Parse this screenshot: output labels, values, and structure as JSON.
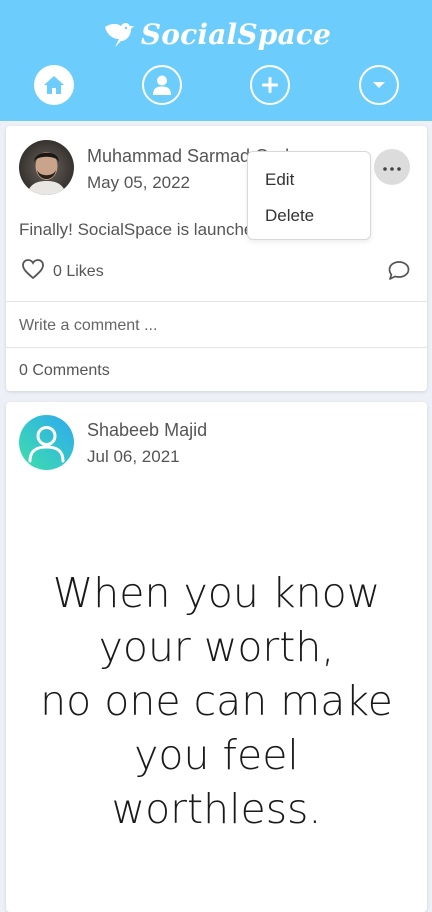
{
  "header": {
    "brand_name": "SocialSpace",
    "nav": [
      {
        "name": "home",
        "icon": "home-icon",
        "active": true
      },
      {
        "name": "profile",
        "icon": "user-icon",
        "active": false
      },
      {
        "name": "create",
        "icon": "plus-icon",
        "active": false
      },
      {
        "name": "menu",
        "icon": "chevron-down-icon",
        "active": false
      }
    ]
  },
  "colors": {
    "header_bg": "#6ccdfc",
    "page_bg": "#eef0f8",
    "accent_gradient": [
      "#3ee0a8",
      "#2ea9f2"
    ]
  },
  "posts": [
    {
      "author": "Muhammad Sarmad Qadeer",
      "date": "May 05, 2022",
      "text": "Finally! SocialSpace is launched",
      "likes_label": "0 Likes",
      "comment_placeholder": "Write a comment ...",
      "comments_label": "0 Comments",
      "menu": {
        "open": true,
        "items": [
          "Edit",
          "Delete"
        ]
      }
    },
    {
      "author": "Shabeeb Majid",
      "date": "Jul 06, 2021",
      "image_quote": "When you know\nyour worth,\nno one can make\nyou feel\nworthless."
    }
  ]
}
